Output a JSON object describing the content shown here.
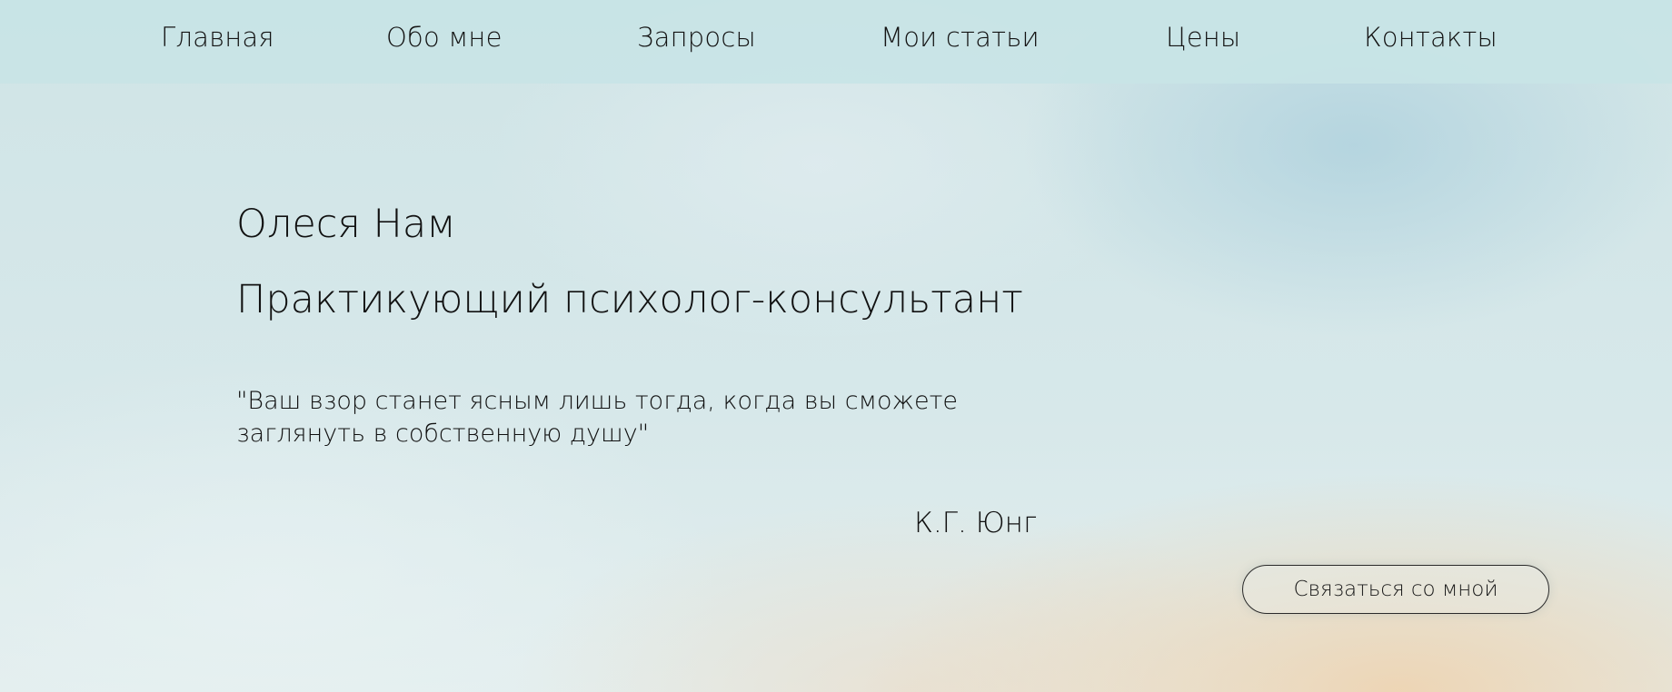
{
  "nav": {
    "items": [
      {
        "label": "Главная"
      },
      {
        "label": "Обо мне"
      },
      {
        "label": "Запросы"
      },
      {
        "label": "Мои статьи"
      },
      {
        "label": "Цены"
      },
      {
        "label": "Контакты"
      }
    ]
  },
  "hero": {
    "name": "Олеся Нам",
    "title": "Практикующий психолог-консультант",
    "quote_line1": "\"Ваш взор станет ясным лишь тогда, когда вы сможете",
    "quote_line2": "заглянуть в собственную душу\"",
    "author": "К.Г. Юнг",
    "contact_button": "Связаться со мной"
  },
  "colors": {
    "nav_bg": "#c8e4e6",
    "bg_blue": "#b0d2de",
    "bg_peach": "#eed4b2",
    "text": "#111111"
  }
}
